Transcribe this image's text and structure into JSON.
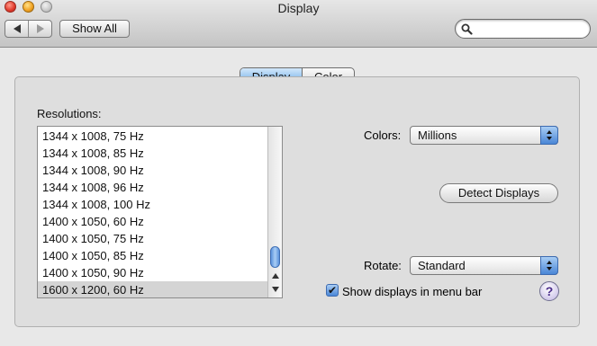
{
  "window": {
    "title": "Display"
  },
  "toolbar": {
    "show_all_label": "Show All",
    "search_placeholder": "",
    "search_value": ""
  },
  "tabs": [
    {
      "label": "Display",
      "selected": true
    },
    {
      "label": "Color",
      "selected": false
    }
  ],
  "resolutions": {
    "label": "Resolutions:",
    "items": [
      "1344 x 1008, 75 Hz",
      "1344 x 1008, 85 Hz",
      "1344 x 1008, 90 Hz",
      "1344 x 1008, 96 Hz",
      "1344 x 1008, 100 Hz",
      "1400 x 1050, 60 Hz",
      "1400 x 1050, 75 Hz",
      "1400 x 1050, 85 Hz",
      "1400 x 1050, 90 Hz",
      "1600 x 1200, 60 Hz"
    ],
    "selected": "1600 x 1200, 60 Hz"
  },
  "colors": {
    "label": "Colors:",
    "value": "Millions"
  },
  "detect_label": "Detect Displays",
  "rotate": {
    "label": "Rotate:",
    "value": "Standard"
  },
  "menu_bar_checkbox": {
    "label": "Show displays in menu bar",
    "checked": true
  },
  "help_label": "?",
  "accent_color": "#7bb3ea"
}
